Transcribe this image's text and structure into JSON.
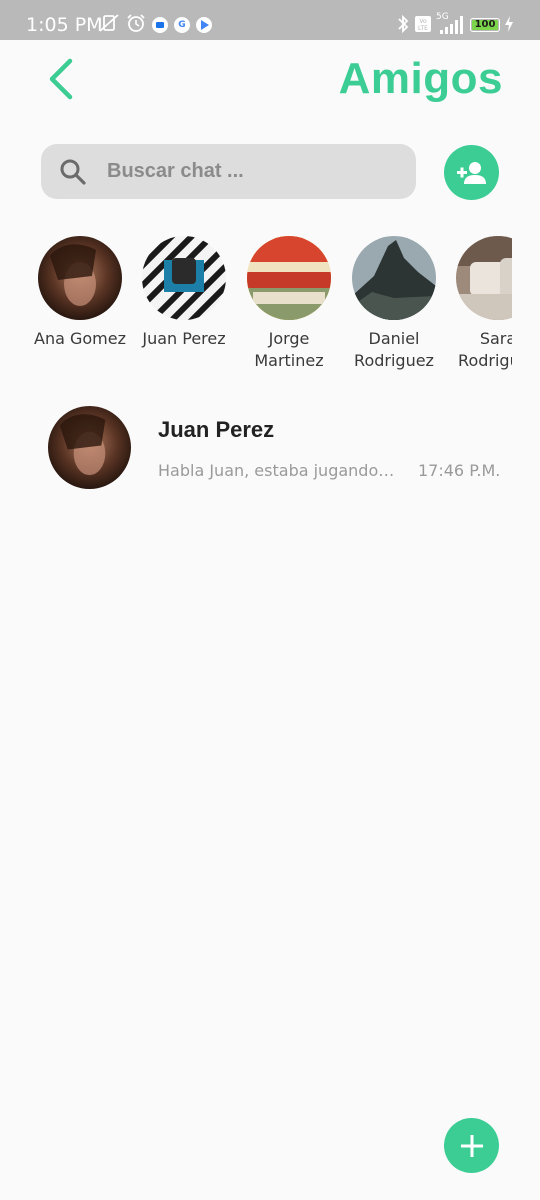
{
  "status_bar": {
    "time": "1:05 PM",
    "network": "5G",
    "volte": "Vo LTE",
    "battery": "100",
    "battery_level": 1.0,
    "icons": [
      "vibrate-off-icon",
      "alarm-icon",
      "messages-icon",
      "google-icon",
      "play-icon",
      "bluetooth-icon",
      "volte-icon",
      "signal-icon",
      "battery-icon",
      "charging-icon"
    ]
  },
  "header": {
    "title": "Amigos",
    "back_icon": "chevron-left-icon"
  },
  "search": {
    "placeholder": "Buscar chat ...",
    "value": ""
  },
  "friends": [
    {
      "name": "Ana Gomez",
      "avatar": "portrait-woman"
    },
    {
      "name": "Juan Perez",
      "avatar": "binoculars-stripes"
    },
    {
      "name": "Jorge Martinez",
      "avatar": "storefront-sign"
    },
    {
      "name": "Daniel Rodriguez",
      "avatar": "mountain-peak"
    },
    {
      "name": "Sara Rodriguez",
      "avatar": "pillows-bed"
    }
  ],
  "chats": [
    {
      "name": "Juan Perez",
      "preview": "Habla Juan, estaba jugando un juego nuevo",
      "time": "17:46 P.M."
    }
  ],
  "colors": {
    "accent": "#3ccd95",
    "search_bg": "#dddddd",
    "background": "#fafafa",
    "status_bar": "#b9b9b9"
  }
}
